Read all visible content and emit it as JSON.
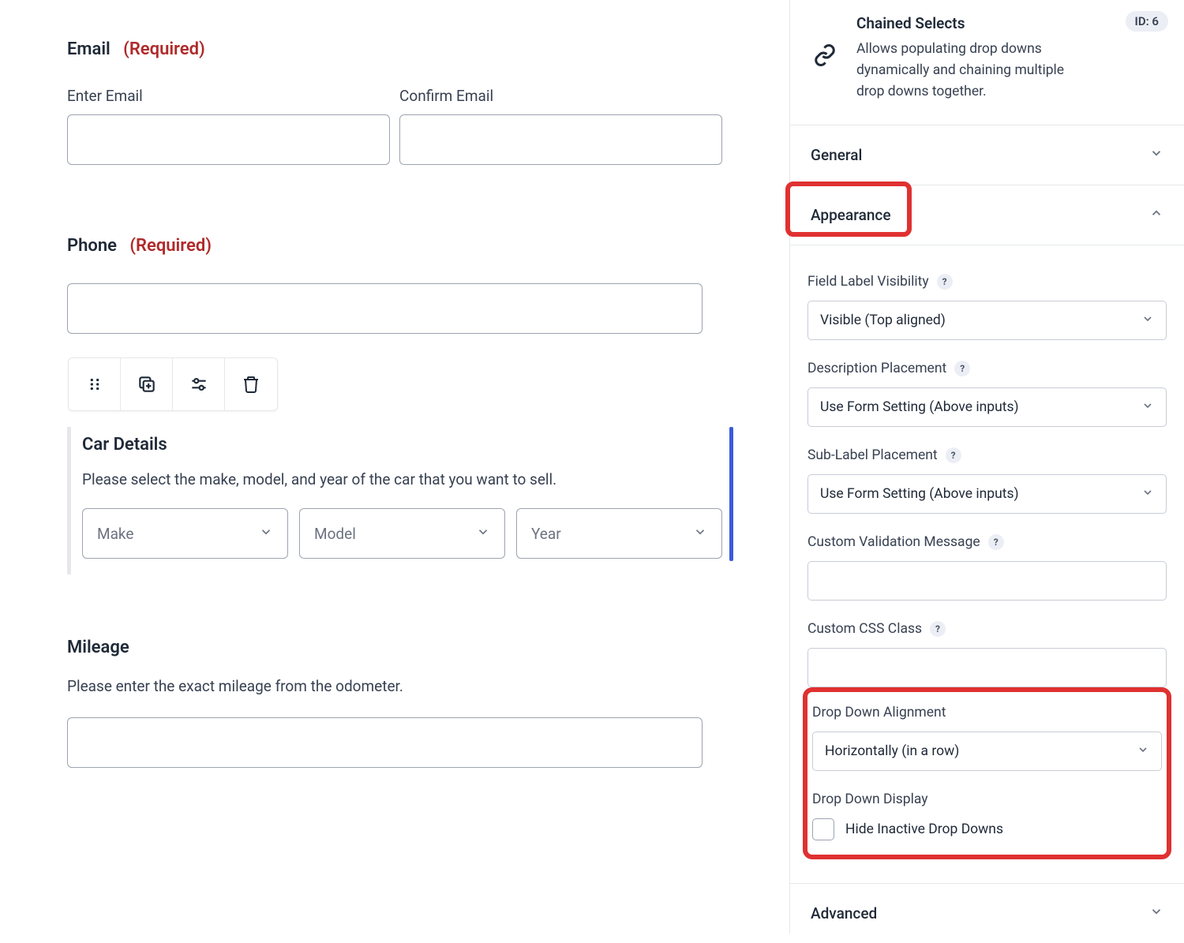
{
  "form": {
    "email": {
      "label": "Email",
      "required": "(Required)",
      "enter_label": "Enter Email",
      "confirm_label": "Confirm Email"
    },
    "phone": {
      "label": "Phone",
      "required": "(Required)"
    },
    "car": {
      "title": "Car Details",
      "desc": "Please select the make, model, and year of the car that you want to sell.",
      "make_ph": "Make",
      "model_ph": "Model",
      "year_ph": "Year"
    },
    "mileage": {
      "title": "Mileage",
      "desc": "Please enter the exact mileage from the odometer."
    }
  },
  "sidebar": {
    "header": {
      "title": "Chained Selects",
      "desc": "Allows populating drop downs dynamically and chaining multiple drop downs together.",
      "id_badge": "ID: 6"
    },
    "sections": {
      "general": "General",
      "appearance": "Appearance",
      "advanced": "Advanced"
    },
    "appearance": {
      "field_label_visibility": {
        "label": "Field Label Visibility",
        "value": "Visible (Top aligned)"
      },
      "description_placement": {
        "label": "Description Placement",
        "value": "Use Form Setting (Above inputs)"
      },
      "sublabel_placement": {
        "label": "Sub-Label Placement",
        "value": "Use Form Setting (Above inputs)"
      },
      "custom_validation": {
        "label": "Custom Validation Message",
        "value": ""
      },
      "custom_css": {
        "label": "Custom CSS Class",
        "value": ""
      },
      "dd_alignment": {
        "label": "Drop Down Alignment",
        "value": "Horizontally (in a row)"
      },
      "dd_display": {
        "label": "Drop Down Display",
        "checkbox_label": "Hide Inactive Drop Downs"
      }
    }
  }
}
